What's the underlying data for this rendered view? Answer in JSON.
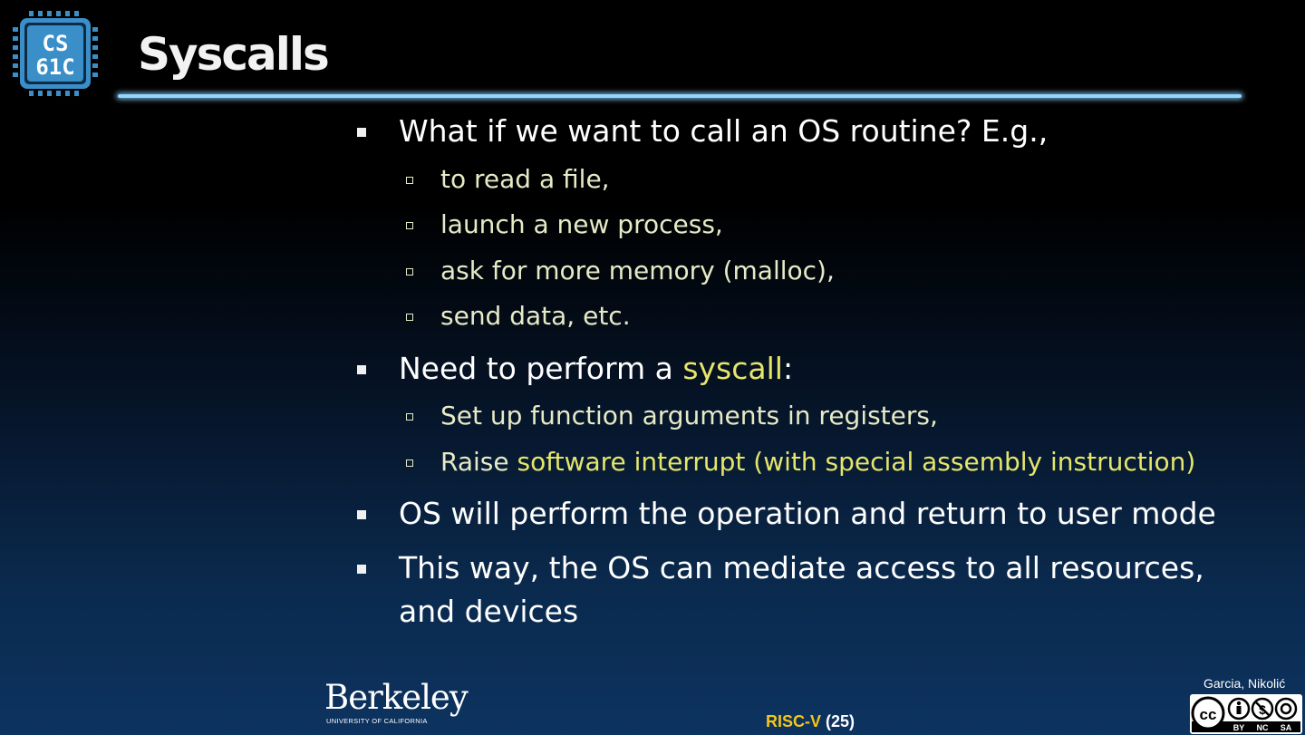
{
  "slide": {
    "title": "Syscalls",
    "logo_text": [
      "CS",
      "61C"
    ],
    "bullets": [
      {
        "text": "What if we want to call an OS routine? E.g.,",
        "subs": [
          {
            "text": "to read a file,"
          },
          {
            "text": "launch a new process,"
          },
          {
            "text": "ask for more memory (malloc),"
          },
          {
            "text": "send data, etc."
          }
        ]
      },
      {
        "text_before": "Need to perform a ",
        "highlight": "syscall",
        "text_after": ":",
        "subs": [
          {
            "text": "Set up function arguments in registers,"
          },
          {
            "text_before": "Raise ",
            "highlight": "software interrupt (with special assembly instruction)"
          }
        ]
      },
      {
        "text": "OS will perform the operation and return to user mode"
      },
      {
        "line1": "This way, the OS can mediate access to all resources,",
        "line2": "and devices"
      }
    ]
  },
  "footer": {
    "institution": "Berkeley",
    "institution_sub": "UNIVERSITY OF CALIFORNIA",
    "topic": "RISC-V",
    "page": "(25)",
    "authors": "Garcia, Nikolić",
    "license_labels": [
      "BY",
      "NC",
      "SA"
    ]
  },
  "colors": {
    "highlight": "#e6e66a",
    "subtext": "#e6eac6",
    "rule": "#8fd7ff",
    "topic": "#f5c518",
    "logo_blue": "#3b8fc9"
  }
}
